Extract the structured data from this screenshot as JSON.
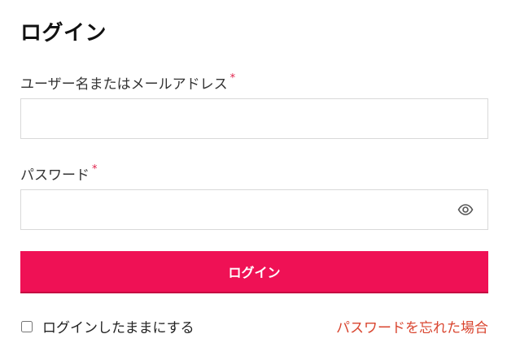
{
  "login_form": {
    "title": "ログイン",
    "username": {
      "label": "ユーザー名またはメールアドレス",
      "required_mark": "*",
      "value": "",
      "placeholder": ""
    },
    "password": {
      "label": "パスワード",
      "required_mark": "*",
      "value": "",
      "placeholder": "",
      "toggle_icon": "eye-icon"
    },
    "submit_label": "ログイン",
    "remember_label": "ログインしたままにする",
    "remember_checked": false,
    "forgot_link": "パスワードを忘れた場合"
  },
  "colors": {
    "accent": "#ef1155",
    "link": "#d9452f",
    "required": "#e0214a"
  }
}
